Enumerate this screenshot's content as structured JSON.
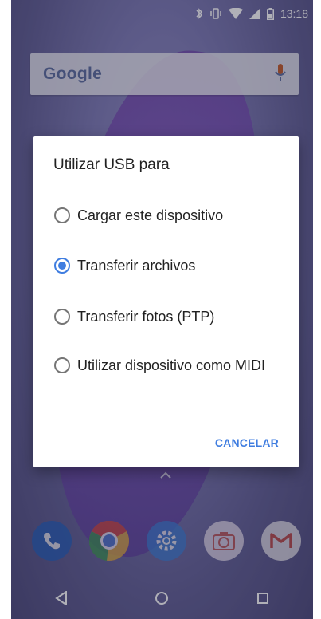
{
  "status_bar": {
    "time": "13:18",
    "icons": [
      "bluetooth-icon",
      "vibrate-icon",
      "wifi-icon",
      "signal-icon",
      "battery-icon"
    ]
  },
  "search": {
    "logo_text": "Google",
    "mic_icon": "mic-icon"
  },
  "dialog": {
    "title": "Utilizar USB para",
    "options": [
      {
        "label": "Cargar este dispositivo",
        "selected": false
      },
      {
        "label": "Transferir archivos",
        "selected": true
      },
      {
        "label": "Transferir fotos (PTP)",
        "selected": false
      },
      {
        "label": "Utilizar dispositivo como MIDI",
        "selected": false
      }
    ],
    "cancel_label": "CANCELAR"
  },
  "dock": {
    "apps": [
      "phone-icon",
      "chrome-icon",
      "settings-icon",
      "camera-icon",
      "gmail-icon"
    ]
  },
  "navbar": {
    "buttons": [
      "back-icon",
      "home-icon",
      "recents-icon"
    ]
  },
  "colors": {
    "accent": "#3f7de0",
    "dialog_bg": "#ffffff"
  }
}
